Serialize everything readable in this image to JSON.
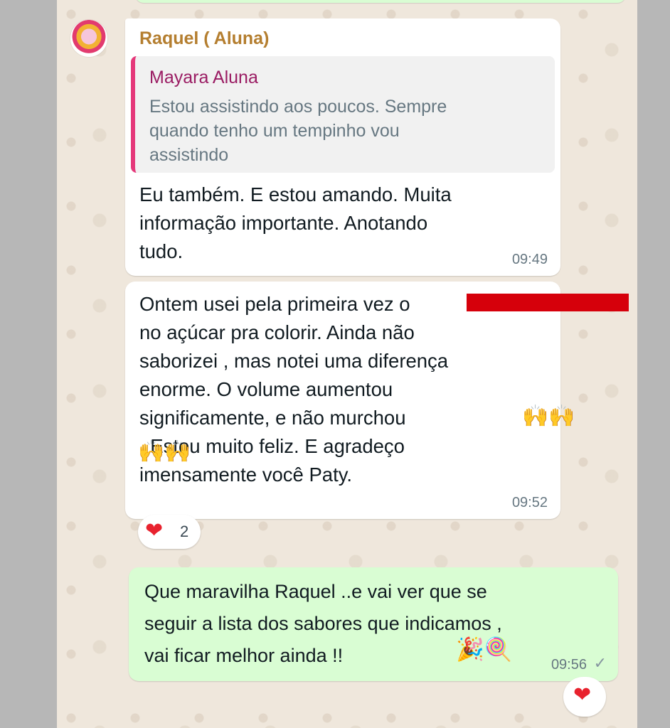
{
  "messages": [
    {
      "sender": "Raquel ( Aluna)",
      "reply_to": {
        "author": "Mayara Aluna",
        "text": "Estou assistindo aos poucos. Sempre\nquando tenho um tempinho vou\nassistindo"
      },
      "text": "Eu também. E estou amando. Muita\ninformação importante. Anotando\ntudo.",
      "time": "09:49"
    },
    {
      "text": "Ontem usei pela primeira vez o\nno açúcar pra colorir. Ainda não\nsaborizei , mas notei uma diferença\nenorme. O volume aumentou\nsignificamente, e não murchou\n          . Estou muito feliz. E agradeço\nimensamente você Paty.",
      "emoji_1": "🙌🙌",
      "emoji_2": "🙌🙌",
      "time": "09:52",
      "reaction": {
        "emoji": "❤",
        "count": "2"
      }
    },
    {
      "text": "Que maravilha Raquel ..e vai ver que se\nseguir a lista  dos sabores que indicamos ,\nvai ficar melhor ainda !!",
      "emoji_party": "🎉",
      "emoji_lollipop": "🍭",
      "time": "09:56",
      "status": "✓",
      "reaction": {
        "emoji": "❤"
      }
    }
  ],
  "colors": {
    "chat_bg": "#efe7dc",
    "outgoing_bubble": "#d9fdd3",
    "sender_name": "#b47e2f",
    "quote_bar": "#e5387a",
    "redaction": "#d6000b"
  },
  "icons": [
    "avatar-image",
    "heart-icon",
    "single-check-icon"
  ]
}
